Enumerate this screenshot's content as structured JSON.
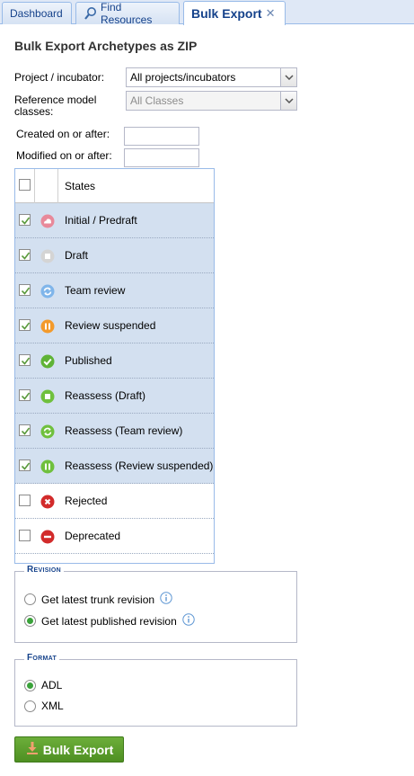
{
  "tabs": [
    {
      "label": "Dashboard"
    },
    {
      "label": "Find Resources",
      "icon": "magnifier-icon"
    },
    {
      "label": "Bulk Export",
      "close": "✕"
    }
  ],
  "page": {
    "title": "Bulk Export Archetypes as ZIP"
  },
  "form": {
    "project_label": "Project / incubator:",
    "project_value": "All projects/incubators",
    "ref_model_label_line1": "Reference model",
    "ref_model_label_line2": "classes:",
    "ref_model_value": "All Classes",
    "created_label": "Created on or after:",
    "created_value": "",
    "modified_label": "Modified on or after:",
    "modified_value": ""
  },
  "grid": {
    "header": "States",
    "rows": [
      {
        "label": "Initial / Predraft",
        "checked": true,
        "icon": "initial-state-icon",
        "color": "#e8899a"
      },
      {
        "label": "Draft",
        "checked": true,
        "icon": "draft-state-icon",
        "color": "#c8c8c8"
      },
      {
        "label": "Team review",
        "checked": true,
        "icon": "team-review-icon",
        "color": "#5fa0e0"
      },
      {
        "label": "Review suspended",
        "checked": true,
        "icon": "pause-icon",
        "color": "#f39a2b"
      },
      {
        "label": "Published",
        "checked": true,
        "icon": "check-icon",
        "color": "#5fb336"
      },
      {
        "label": "Reassess (Draft)",
        "checked": true,
        "icon": "reassess-draft-icon",
        "color": "#6fc03d"
      },
      {
        "label": "Reassess (Team review)",
        "checked": true,
        "icon": "reassess-team-review-icon",
        "color": "#6fc03d"
      },
      {
        "label": "Reassess (Review suspended)",
        "checked": true,
        "icon": "reassess-pause-icon",
        "color": "#6fc03d"
      },
      {
        "label": "Rejected",
        "checked": false,
        "icon": "rejected-icon",
        "color": "#d22b2b"
      },
      {
        "label": "Deprecated",
        "checked": false,
        "icon": "deprecated-icon",
        "color": "#d22b2b"
      }
    ]
  },
  "revision": {
    "legend": "Revision",
    "option_trunk": "Get latest trunk revision",
    "option_published": "Get latest published revision",
    "selected": "published"
  },
  "format": {
    "legend": "Format",
    "option_adl": "ADL",
    "option_xml": "XML",
    "selected": "ADL"
  },
  "actions": {
    "export_label": "Bulk Export"
  }
}
